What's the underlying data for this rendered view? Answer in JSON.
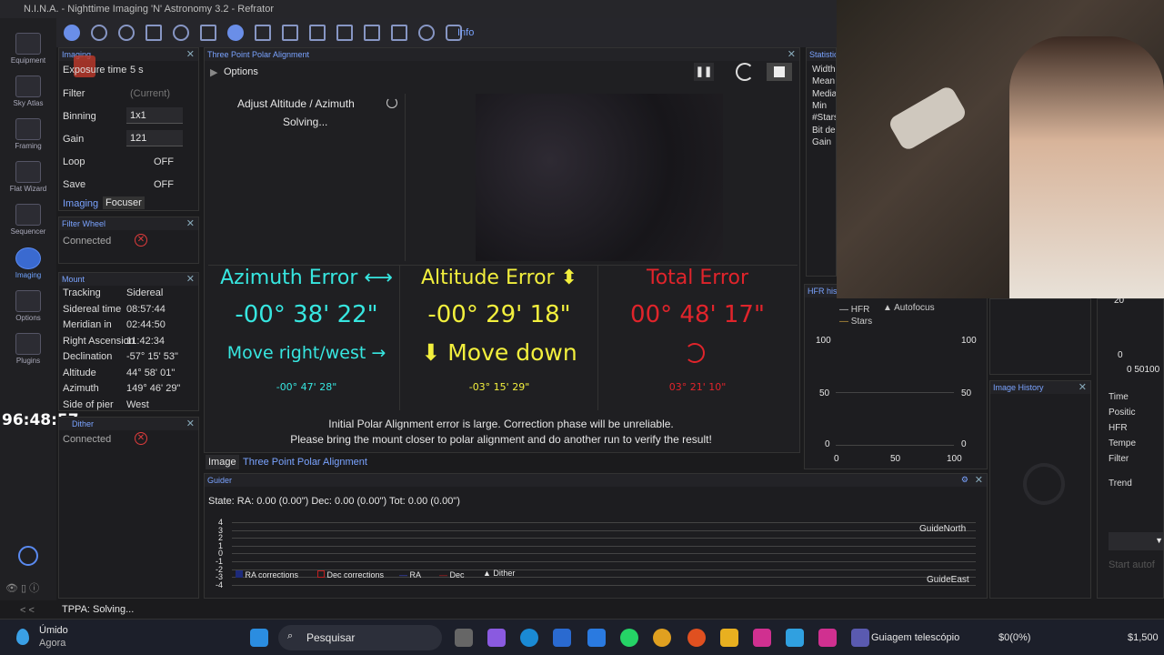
{
  "app": {
    "title": "N.I.N.A. - Nighttime Imaging 'N' Astronomy 3.2  -  Refrator"
  },
  "nav": [
    {
      "label": "Equipment"
    },
    {
      "label": "Sky Atlas"
    },
    {
      "label": "Framing"
    },
    {
      "label": "Flat Wizard"
    },
    {
      "label": "Sequencer"
    },
    {
      "label": "Imaging"
    },
    {
      "label": "Options"
    },
    {
      "label": "Plugins"
    }
  ],
  "toolbar": {
    "info": "Info"
  },
  "imaging": {
    "title": "Imaging",
    "rows": [
      {
        "label": "Exposure time",
        "value": "5  s"
      },
      {
        "label": "Filter",
        "value": "(Current)"
      },
      {
        "label": "Binning",
        "value": "1x1"
      },
      {
        "label": "Gain",
        "value": "121"
      },
      {
        "label": "Loop",
        "value": "OFF"
      },
      {
        "label": "Save",
        "value": "OFF"
      }
    ],
    "tab1": "Imaging",
    "tab2": "Focuser"
  },
  "filterwheel": {
    "title": "Filter Wheel",
    "status": "Connected"
  },
  "mount": {
    "title": "Mount",
    "rows": [
      {
        "label": "Tracking",
        "value": "Sidereal"
      },
      {
        "label": "Sidereal time",
        "value": "08:57:44"
      },
      {
        "label": "Meridian in",
        "value": "02:44:50"
      },
      {
        "label": "Right Ascension",
        "value": "11:42:34"
      },
      {
        "label": "Declination",
        "value": "-57° 15' 53\""
      },
      {
        "label": "Altitude",
        "value": "44° 58' 01\""
      },
      {
        "label": "Azimuth",
        "value": "149° 46' 29\""
      },
      {
        "label": "Side of pier",
        "value": "West"
      }
    ]
  },
  "timer": "96:48:57",
  "dither": {
    "title": "Dither",
    "status": "Connected"
  },
  "tppa": {
    "title": "Three Point Polar Alignment",
    "options": "Options",
    "step": "Adjust Altitude / Azimuth",
    "status": "Solving...",
    "az": {
      "title": "Azimuth Error ⟷",
      "value": "-00° 38' 22\"",
      "move": "Move right/west →",
      "sub": "-00° 47' 28\""
    },
    "alt": {
      "title": "Altitude Error ⬍",
      "value": "-00° 29' 18\"",
      "move": "⬇ Move down",
      "sub": "-03° 15' 29\""
    },
    "tot": {
      "title": "Total Error",
      "value": "00° 48' 17\"",
      "sub": "03° 21' 10\""
    },
    "msg1": "Initial Polar Alignment error is large. Correction phase will be unreliable.",
    "msg2": "Please bring the mount closer to polar alignment and do another run to verify the result!",
    "tab_image": "Image",
    "tab_tppa": "Three Point Polar Alignment"
  },
  "statistics": {
    "title": "Statistics",
    "rows": [
      "Width",
      "Mean",
      "Media",
      "Min",
      "#Stars",
      "Bit dep",
      "Gain"
    ]
  },
  "hfr": {
    "title": "HFR histo",
    "legend": [
      "HFR",
      "Autofocus",
      "Stars"
    ],
    "yticks": [
      "100",
      "50",
      "0"
    ],
    "xticks": [
      "0",
      "50",
      "100"
    ]
  },
  "imagehistory": {
    "title": "Image History"
  },
  "rightcol": {
    "rows": [
      "Time",
      "Positic",
      "HFR",
      "Tempe",
      "Filter",
      "Trend"
    ],
    "ticks": [
      "20",
      "0",
      "0 50100"
    ],
    "start": "Start autof"
  },
  "guider": {
    "title": "Guider",
    "state": "State:  RA: 0.00 (0.00\")  Dec: 0.00 (0.00\")  Tot: 0.00 (0.00\")",
    "yticks": [
      "4",
      "3",
      "2",
      "1",
      "0",
      "-1",
      "-2",
      "-3",
      "-4"
    ],
    "north": "GuideNorth",
    "east": "GuideEast",
    "legend": [
      "RA corrections",
      "Dec corrections",
      "RA",
      "Dec",
      "Dither"
    ]
  },
  "statusbar": {
    "text": "TPPA:  Solving...",
    "collapse": "< <"
  },
  "taskbar": {
    "weather": "Úmido",
    "weather2": "Agora",
    "search": "Pesquisar",
    "active": "Guiagem telescópio",
    "stock1": "$0(0%)",
    "stock2": "$1,500"
  },
  "colors": {
    "accent": "#6fa3ff",
    "cyan": "#37e6e0",
    "yellow": "#f2ef3d",
    "red": "#e0242b"
  }
}
